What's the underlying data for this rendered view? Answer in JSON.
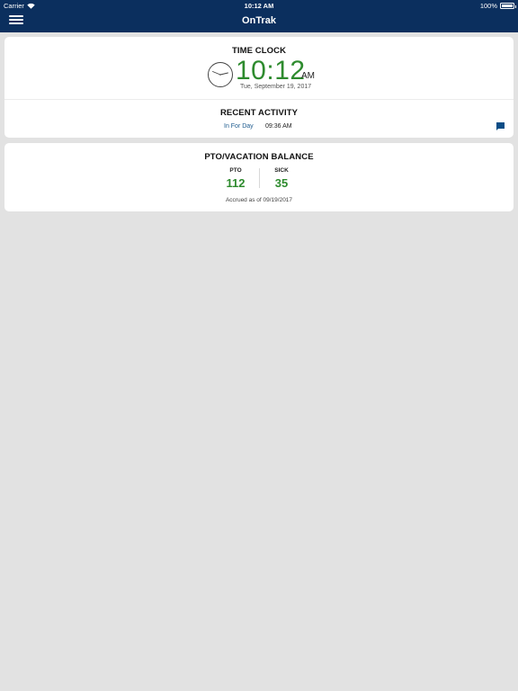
{
  "status_bar": {
    "carrier": "Carrier",
    "time": "10:12 AM",
    "battery": "100%"
  },
  "nav": {
    "title": "OnTrak",
    "menu_icon": "hamburger-menu-icon"
  },
  "time_clock": {
    "title": "TIME CLOCK",
    "time": "10:12",
    "ampm": "AM",
    "date": "Tue, September 19, 2017",
    "clock_icon": "analog-clock-icon"
  },
  "recent_activity": {
    "title": "RECENT ACTIVITY",
    "entry_type": "In For Day",
    "entry_time": "09:36 AM",
    "note_icon": "chat-bubble-icon"
  },
  "balance": {
    "title": "PTO/VACATION BALANCE",
    "pto_label": "PTO",
    "pto_value": "112",
    "sick_label": "SICK",
    "sick_value": "35",
    "accrued": "Accrued as of 09/19/2017"
  },
  "colors": {
    "nav_background": "#0b2f5e",
    "accent_green": "#2e8b2e",
    "link_blue": "#1c5a8e",
    "page_background": "#e2e2e2"
  }
}
